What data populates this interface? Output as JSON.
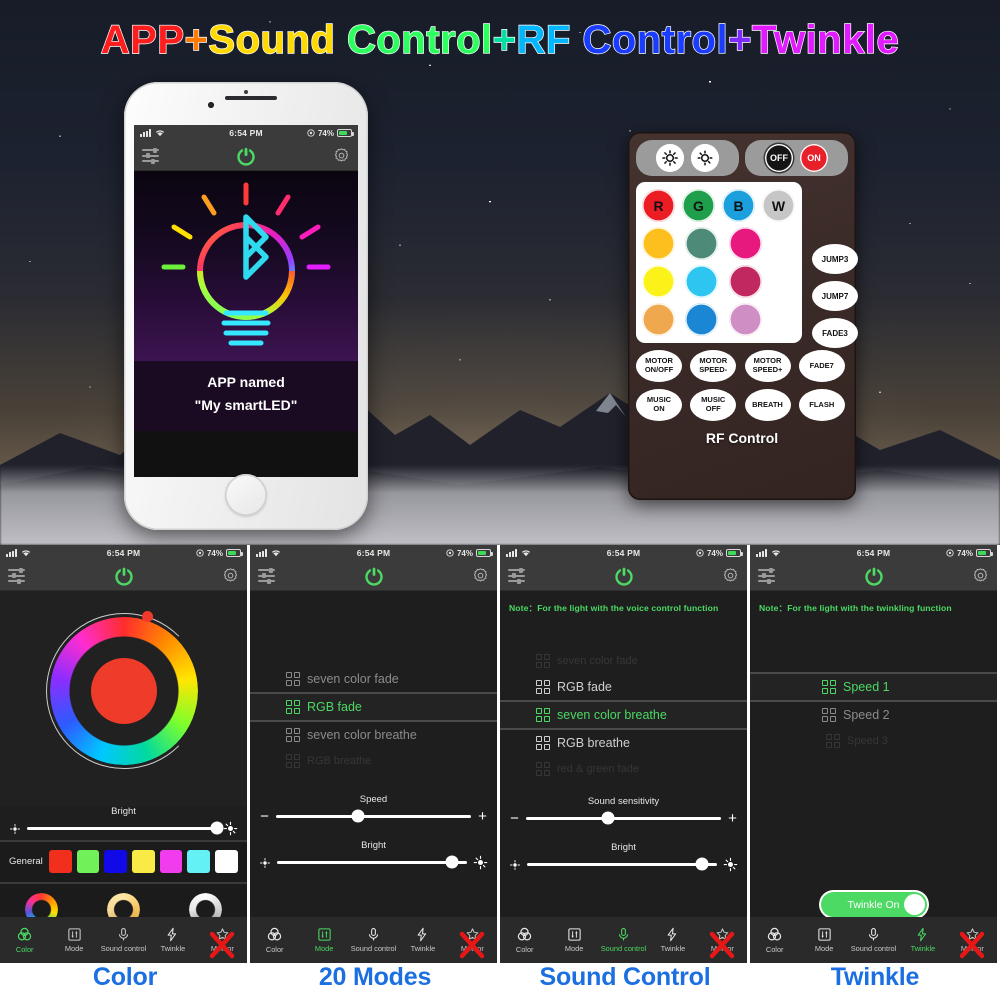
{
  "hero": {
    "title_parts": [
      {
        "text": "APP",
        "cls": "t1"
      },
      {
        "text": "+",
        "cls": "t2"
      },
      {
        "text": "Sound",
        "cls": "t3"
      },
      {
        "text": " ",
        "cls": "t4"
      },
      {
        "text": "Control",
        "cls": "t5"
      },
      {
        "text": "+",
        "cls": "t6"
      },
      {
        "text": "RF",
        "cls": "t7"
      },
      {
        "text": " ",
        "cls": "t7"
      },
      {
        "text": "Control",
        "cls": "t8"
      },
      {
        "text": "+",
        "cls": "t9"
      },
      {
        "text": "Twinkle",
        "cls": "t10"
      }
    ],
    "title_plain": "APP+Sound Control+RF Control+Twinkle"
  },
  "phone": {
    "status": {
      "time": "6:54 PM",
      "battery_percent": "74%",
      "signal_icon": "signal-bars-icon",
      "wifi_icon": "wifi-icon",
      "location_icon": "location-icon",
      "battery_icon": "battery-icon"
    },
    "appbar": {
      "menu_icon": "sliders-icon",
      "power_icon": "power-icon",
      "settings_icon": "gear-icon"
    },
    "art": {
      "bulb_icon": "light-bulb-icon",
      "bluetooth_icon": "bluetooth-icon"
    },
    "caption_line1": "APP named",
    "caption_line2": "\"My smartLED\""
  },
  "remote": {
    "label": "RF Control",
    "top_buttons": [
      {
        "name": "brightness-up-button",
        "text": "",
        "icon": "sun-up-icon",
        "style": "white"
      },
      {
        "name": "brightness-down-button",
        "text": "",
        "icon": "sun-down-icon",
        "style": "white"
      },
      {
        "name": "off-button",
        "text": "OFF",
        "style": "black"
      },
      {
        "name": "on-button",
        "text": "ON",
        "style": "red"
      }
    ],
    "rgbw_row": [
      {
        "label": "R",
        "color": "#ec1c24"
      },
      {
        "label": "G",
        "color": "#1f9e4b"
      },
      {
        "label": "B",
        "color": "#1ba0dd"
      },
      {
        "label": "W",
        "color": "#c6c6c6"
      }
    ],
    "color_grid": [
      [
        "#fcbf1e",
        "#4e8a78",
        "#e8197e"
      ],
      [
        "#fbf21a",
        "#2ec6f0",
        "#c0285f"
      ],
      [
        "#f0a84e",
        "#1b86d4",
        "#cf8fc4"
      ]
    ],
    "side_buttons": [
      "JUMP3",
      "JUMP7",
      "FADE3"
    ],
    "bottom_buttons": [
      "MOTOR ON/OFF",
      "MOTOR SPEED-",
      "MOTOR SPEED+",
      "FADE7",
      "MUSIC ON",
      "MUSIC OFF",
      "BREATH",
      "FLASH"
    ]
  },
  "tabs": [
    {
      "label": "Color",
      "icon": "color-rings-icon"
    },
    {
      "label": "Mode",
      "icon": "mode-sliders-icon"
    },
    {
      "label": "Sound control",
      "icon": "microphone-icon"
    },
    {
      "label": "Twinkle",
      "icon": "lightning-bolt-icon"
    },
    {
      "label": "Meteor",
      "icon": "shooting-star-icon"
    }
  ],
  "panels": [
    {
      "id": "color",
      "caption": "Color",
      "active_tab": 0,
      "status": {
        "time": "6:54 PM",
        "battery_percent": "74%"
      },
      "wheel": {
        "selected_color": "#ef3b2a",
        "knob_color": "#f0392b"
      },
      "sliders": [
        {
          "name": "brightness-slider",
          "label": "Bright",
          "value": 100,
          "left_icon": "sun-small-icon",
          "right_icon": "sun-large-icon"
        }
      ],
      "general": {
        "label": "General",
        "swatches": [
          "#f22f1d",
          "#72f05a",
          "#1109e8",
          "#f9ea45",
          "#f13ced",
          "#63f1f6",
          "#ffffff"
        ]
      },
      "presets": [
        "rainbow-ring",
        "warm-ring",
        "white-ring"
      ]
    },
    {
      "id": "modes",
      "caption": "20 Modes",
      "active_tab": 1,
      "status": {
        "time": "6:54 PM",
        "battery_percent": "74%"
      },
      "note": "",
      "modes": [
        {
          "label": "seven color fade",
          "state": "dim"
        },
        {
          "label": "RGB fade",
          "state": "active"
        },
        {
          "label": "seven color breathe",
          "state": "dim"
        },
        {
          "label": "RGB breathe",
          "state": "dim2"
        }
      ],
      "sliders": [
        {
          "name": "speed-slider",
          "label": "Speed",
          "value": 42,
          "left_icon": "minus-icon",
          "right_icon": "plus-icon"
        },
        {
          "name": "brightness-slider",
          "label": "Bright",
          "value": 92,
          "left_icon": "sun-small-icon",
          "right_icon": "sun-large-icon"
        }
      ]
    },
    {
      "id": "sound",
      "caption": "Sound Control",
      "active_tab": 2,
      "status": {
        "time": "6:54 PM",
        "battery_percent": "74%"
      },
      "note": "Note：For the light with the voice control function",
      "modes": [
        {
          "label": "seven color fade",
          "state": "dim2"
        },
        {
          "label": "RGB fade",
          "state": "dim"
        },
        {
          "label": "seven color breathe",
          "state": "active"
        },
        {
          "label": "RGB breathe",
          "state": "dim"
        },
        {
          "label": "red & green fade",
          "state": "dim2"
        }
      ],
      "sliders": [
        {
          "name": "sound-sensitivity-slider",
          "label": "Sound sensitivity",
          "value": 42,
          "left_icon": "minus-icon",
          "right_icon": "plus-icon"
        },
        {
          "name": "brightness-slider",
          "label": "Bright",
          "value": 92,
          "left_icon": "sun-small-icon",
          "right_icon": "sun-large-icon"
        }
      ]
    },
    {
      "id": "twinkle",
      "caption": "Twinkle",
      "active_tab": 3,
      "status": {
        "time": "6:54 PM",
        "battery_percent": "74%"
      },
      "note": "Note：For the light with the twinkling function",
      "modes": [
        {
          "label": "Speed 1",
          "state": "active"
        },
        {
          "label": "Speed 2",
          "state": "dim"
        },
        {
          "label": "Speed 3",
          "state": "dim2"
        }
      ],
      "toggle": {
        "label": "Twinkle On",
        "on": true
      }
    }
  ],
  "colors": {
    "accent_green": "#4cd964",
    "caption_blue": "#1b6fe0",
    "app_dark": "#1e1e1e"
  }
}
